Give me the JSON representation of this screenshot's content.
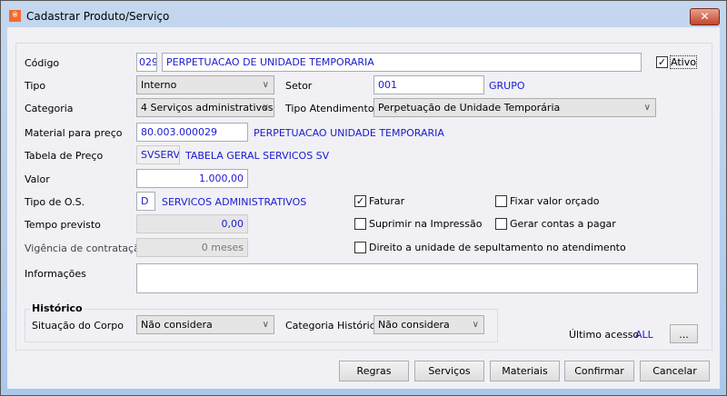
{
  "window": {
    "title": "Cadastrar Produto/Serviço",
    "close": "✕"
  },
  "form": {
    "codigo_label": "Código",
    "codigo": "029",
    "nome": "PERPETUACAO DE UNIDADE TEMPORARIA",
    "ativo_label": "Ativo",
    "ativo": true,
    "tipo_label": "Tipo",
    "tipo": "Interno",
    "setor_label": "Setor",
    "setor": "001",
    "setor_nome": "GRUPO",
    "categoria_label": "Categoria",
    "categoria": "4 Serviços administrativos",
    "tipo_atendimento_label": "Tipo Atendimento",
    "tipo_atendimento": "Perpetuação de Unidade Temporária",
    "material_label": "Material para preço",
    "material": "80.003.000029",
    "material_nome": "PERPETUACAO UNIDADE TEMPORARIA",
    "tabela_label": "Tabela de Preço",
    "tabela": "SVSERV",
    "tabela_nome": "TABELA GERAL SERVICOS SV",
    "valor_label": "Valor",
    "valor": "1.000,00",
    "tipo_os_label": "Tipo de O.S.",
    "tipo_os": "D",
    "tipo_os_nome": "SERVICOS ADMINISTRATIVOS",
    "tempo_label": "Tempo previsto",
    "tempo": "0,00",
    "vigencia_label": "Vigência de contratação",
    "vigencia": "0 meses",
    "informacoes_label": "Informações",
    "informacoes": "",
    "checks": {
      "faturar": "Faturar",
      "fixar": "Fixar valor orçado",
      "suprimir": "Suprimir na Impressão",
      "gerar": "Gerar contas a pagar",
      "direito": "Direito a unidade de sepultamento no atendimento"
    }
  },
  "historico": {
    "title": "Histórico",
    "situacao_label": "Situação do Corpo",
    "situacao": "Não considera",
    "categoria_label": "Categoria Histórico",
    "categoria": "Não considera"
  },
  "ultimo_acesso": {
    "label": "Último acesso",
    "value": "ALL",
    "button": "..."
  },
  "buttons": {
    "regras": "Regras",
    "servicos": "Serviços",
    "materiais": "Materiais",
    "confirmar": "Confirmar",
    "cancelar": "Cancelar"
  }
}
